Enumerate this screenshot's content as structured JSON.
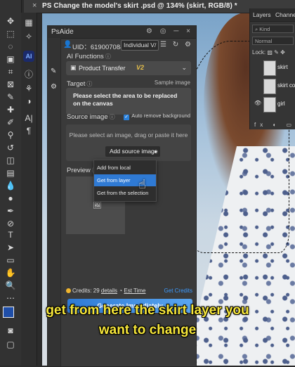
{
  "document": {
    "tab_title": "PS Change the model's skirt .psd @ 134% (skirt, RGB/8) *",
    "close_glyph": "×"
  },
  "plugin": {
    "name": "PsAide",
    "header_icons": "⚙ ◎ ─ ×",
    "uid": "UID：619007084",
    "plan": "Individual V/",
    "user_row_icons": "☰ ↻ ⚙",
    "ai_functions_label": "AI Functions",
    "function_select": {
      "value": "Product Transfer",
      "version": "V2"
    },
    "target_label": "Target",
    "sample_image_link": "Sample image",
    "target_message": "Please select the area to be replaced on the canvas",
    "source_image_label": "Source image",
    "auto_remove_background": {
      "label": "Auto remove background",
      "checked": true
    },
    "source_hint": "Please select an image, drag or paste it here",
    "add_source_button": "Add source image",
    "preview_label": "Preview",
    "dropdown": {
      "items": [
        "Add from local",
        "Get from layer",
        "Get from the selection"
      ],
      "active_index": 1
    },
    "credits": {
      "label": "Credits: 29",
      "details_link": "details",
      "est_time_link": "Est Time",
      "get_credits_link": "Get Credits"
    },
    "generate_button": "Generate Immediately"
  },
  "layers_panel": {
    "tabs": [
      "Layers",
      "Channels"
    ],
    "kind_filter": "Kind",
    "blend_mode": "Normal",
    "lock_label": "Lock:",
    "layers": [
      {
        "name": "skirt",
        "visible": false
      },
      {
        "name": "skirt copy",
        "visible": false
      },
      {
        "name": "girl",
        "visible": true
      }
    ],
    "bottom_icons": "fx ◐ ▭"
  },
  "subtitle": {
    "line1": "get from here the skirt layer you",
    "line2": "want to change"
  },
  "colors": {
    "accent_blue": "#2f7ad4",
    "version_gold": "#e8c14a",
    "subtitle_yellow": "#f6e63a",
    "credits_coin": "#f0b52e"
  }
}
